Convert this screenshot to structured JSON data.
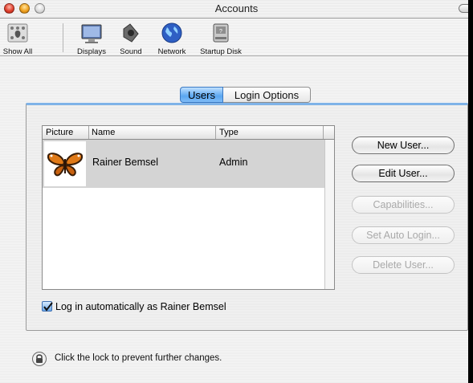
{
  "window": {
    "title": "Accounts"
  },
  "toolbar": {
    "items": [
      {
        "label": "Show All",
        "icon": "apple-grid-icon"
      },
      {
        "label": "Displays",
        "icon": "display-icon"
      },
      {
        "label": "Sound",
        "icon": "speaker-icon"
      },
      {
        "label": "Network",
        "icon": "globe-icon"
      },
      {
        "label": "Startup Disk",
        "icon": "disk-icon"
      }
    ]
  },
  "tabs": {
    "users": "Users",
    "login_options": "Login Options",
    "selected": "Users"
  },
  "table": {
    "columns": [
      "Picture",
      "Name",
      "Type"
    ],
    "rows": [
      {
        "picture": "butterfly-icon",
        "name": "Rainer Bemsel",
        "type": "Admin"
      }
    ]
  },
  "buttons": {
    "new_user": "New User...",
    "edit_user": "Edit User...",
    "capabilities": "Capabilities...",
    "set_auto_login": "Set Auto Login...",
    "delete_user": "Delete User..."
  },
  "auto_login": {
    "label": "Log in automatically as Rainer Bemsel",
    "checked": true
  },
  "lock": {
    "text": "Click the lock to prevent further changes.",
    "icon": "lock-icon"
  },
  "colors": {
    "accent": "#5aa6f0",
    "selection": "#d4d4d4",
    "disabled_text": "#a9a9a9"
  }
}
